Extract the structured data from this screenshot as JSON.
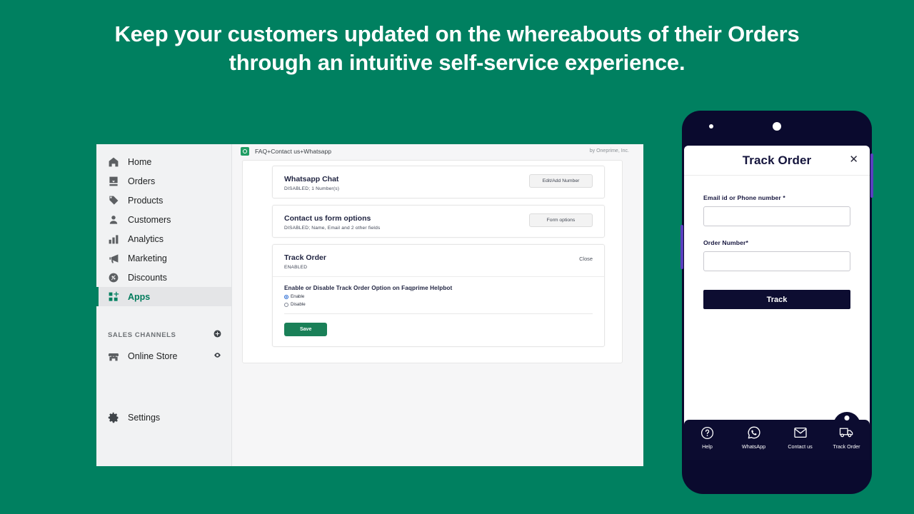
{
  "theme": {
    "background": "#008060",
    "accent_green": "#008060",
    "dark_navy": "#0a0a2e",
    "save_green": "#1a8058",
    "radio_blue": "#2b6cd4"
  },
  "headline": "Keep your customers updated on the whereabouts of their Orders through an intuitive self-service experience.",
  "admin": {
    "sidebar": {
      "items": [
        {
          "label": "Home",
          "icon": "home-icon",
          "active": false
        },
        {
          "label": "Orders",
          "icon": "orders-icon",
          "active": false
        },
        {
          "label": "Products",
          "icon": "products-tag-icon",
          "active": false
        },
        {
          "label": "Customers",
          "icon": "customers-person-icon",
          "active": false
        },
        {
          "label": "Analytics",
          "icon": "analytics-bars-icon",
          "active": false
        },
        {
          "label": "Marketing",
          "icon": "marketing-megaphone-icon",
          "active": false
        },
        {
          "label": "Discounts",
          "icon": "discounts-percent-icon",
          "active": false
        },
        {
          "label": "Apps",
          "icon": "apps-grid-plus-icon",
          "active": true
        }
      ],
      "sales_channels_label": "SALES CHANNELS",
      "add_channel_icon": "plus-circle-icon",
      "channels": [
        {
          "label": "Online Store",
          "icon": "store-icon",
          "action_icon": "eye-icon"
        }
      ],
      "settings": {
        "label": "Settings",
        "icon": "gear-icon"
      }
    },
    "app_bar": {
      "app_name": "FAQ+Contact us+Whatsapp",
      "app_logo_icon": "faqprime-logo-icon",
      "by_line": "by Oneprime, Inc."
    },
    "cards": [
      {
        "title": "Whatsapp Chat",
        "subtitle": "DISABLED; 1 Number(s)",
        "action_label": "Edit/Add Number"
      },
      {
        "title": "Contact us form options",
        "subtitle": "DISABLED; Name, Email and 2 other fields",
        "action_label": "Form options"
      }
    ],
    "track_order_card": {
      "title": "Track Order",
      "subtitle": "ENABLED",
      "close_label": "Close",
      "body_label": "Enable or Disable Track Order Option on Faqprime Helpbot",
      "options": [
        {
          "label": "Enable",
          "selected": true
        },
        {
          "label": "Disable",
          "selected": false
        }
      ],
      "save_label": "Save"
    }
  },
  "phone": {
    "modal": {
      "title": "Track Order",
      "close_icon": "close-x-icon",
      "fields": [
        {
          "label": "Email id or Phone number *",
          "value": "",
          "placeholder": ""
        },
        {
          "label": "Order Number*",
          "value": "",
          "placeholder": ""
        }
      ],
      "submit_label": "Track"
    },
    "tabbar": [
      {
        "label": "Help",
        "icon": "question-circle-icon",
        "active": false
      },
      {
        "label": "WhatsApp",
        "icon": "whatsapp-icon",
        "active": false
      },
      {
        "label": "Contact us",
        "icon": "envelope-icon",
        "active": false
      },
      {
        "label": "Track Order",
        "icon": "truck-icon",
        "active": true
      }
    ]
  }
}
